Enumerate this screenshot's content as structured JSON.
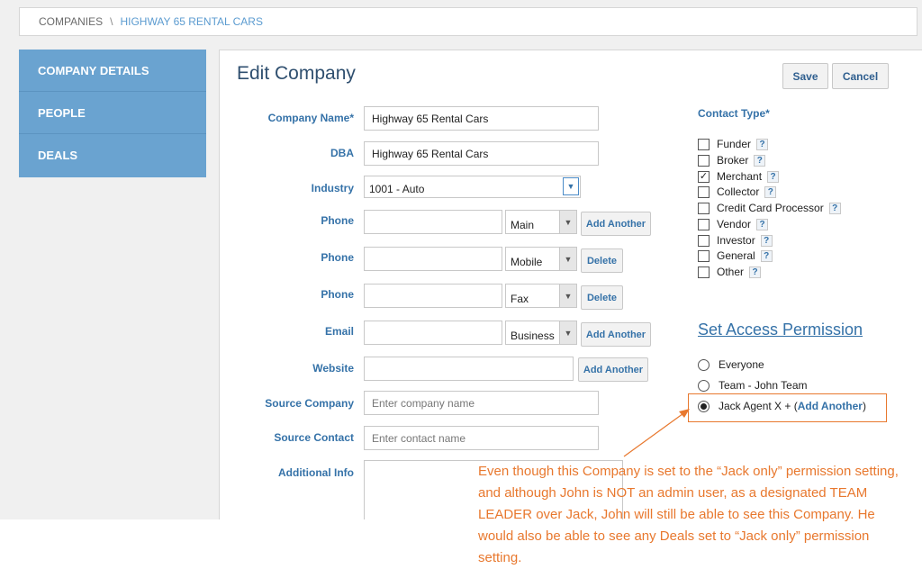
{
  "breadcrumb": {
    "root": "COMPANIES",
    "separator": "\\",
    "current": "HIGHWAY 65 RENTAL CARS"
  },
  "sidebar": {
    "items": [
      {
        "label": "COMPANY DETAILS"
      },
      {
        "label": "PEOPLE"
      },
      {
        "label": "DEALS"
      }
    ]
  },
  "form": {
    "title": "Edit Company",
    "save_label": "Save",
    "cancel_label": "Cancel",
    "company_name": {
      "label": "Company Name*",
      "value": "Highway 65 Rental Cars"
    },
    "dba": {
      "label": "DBA",
      "value": "Highway 65 Rental Cars"
    },
    "industry": {
      "label": "Industry",
      "value": "1001 - Auto"
    },
    "phones": [
      {
        "label": "Phone",
        "value": "",
        "type": "Main",
        "action": "Add Another"
      },
      {
        "label": "Phone",
        "value": "",
        "type": "Mobile",
        "action": "Delete"
      },
      {
        "label": "Phone",
        "value": "",
        "type": "Fax",
        "action": "Delete"
      }
    ],
    "email": {
      "label": "Email",
      "value": "",
      "type": "Business",
      "action": "Add Another"
    },
    "website": {
      "label": "Website",
      "value": "",
      "action": "Add Another"
    },
    "source_company": {
      "label": "Source Company",
      "placeholder": "Enter company name"
    },
    "source_contact": {
      "label": "Source Contact",
      "placeholder": "Enter contact name"
    },
    "additional_info": {
      "label": "Additional Info",
      "value": ""
    }
  },
  "contact_type": {
    "title": "Contact Type*",
    "help": "?",
    "items": [
      {
        "label": "Funder",
        "checked": false
      },
      {
        "label": "Broker",
        "checked": false
      },
      {
        "label": "Merchant",
        "checked": true
      },
      {
        "label": "Collector",
        "checked": false
      },
      {
        "label": "Credit Card Processor",
        "checked": false
      },
      {
        "label": "Vendor",
        "checked": false
      },
      {
        "label": "Investor",
        "checked": false
      },
      {
        "label": "General",
        "checked": false
      },
      {
        "label": "Other",
        "checked": false
      }
    ]
  },
  "permission": {
    "title": "Set Access Permission",
    "options": [
      {
        "label": "Everyone",
        "selected": false
      },
      {
        "label": "Team - John Team",
        "selected": false
      },
      {
        "label": "Jack Agent X + (",
        "link": "Add Another",
        "suffix": ")",
        "selected": true
      }
    ]
  },
  "annotation": {
    "text": "Even though this Company is set to the “Jack only” permission setting, and although John is NOT an admin user, as a designated TEAM LEADER over Jack, John will still be able to see this Company. He would also be able to see any Deals set to “Jack only” permission setting.",
    "color": "#e8782e"
  }
}
